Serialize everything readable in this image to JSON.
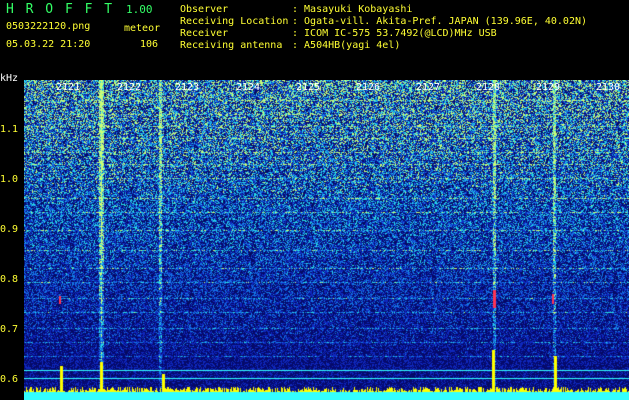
{
  "header": {
    "app_name": "H R O F F T",
    "version": "1.00",
    "filename": "0503222120.png",
    "mode": "meteor",
    "datetime": "05.03.22 21:20",
    "count": "106",
    "info_labels": [
      "Observer",
      "Receiving Location",
      "Receiver",
      "Receiving antenna"
    ],
    "info_values": [
      ": Masayuki Kobayashi",
      ": Ogata-vill. Akita-Pref. JAPAN (139.96E, 40.02N)",
      ": ICOM IC-575 53.7492(@LCD)MHz USB",
      ": A504HB(yagi 4el)"
    ]
  },
  "y_axis": {
    "unit": "kHz",
    "ticks": [
      "1.1",
      "1.0",
      "0.9",
      "0.8",
      "0.7",
      "0.6"
    ]
  },
  "x_axis": {
    "minutes": [
      "2121",
      "2122",
      "2123",
      "2124",
      "2125",
      "2126",
      "2127",
      "2128",
      "2129",
      "2130"
    ]
  },
  "colors": {
    "header_green": "#33ff66",
    "header_yellow": "#ffff33",
    "header_white": "#ffffff",
    "minute_labels": "#ffffff",
    "axis_ticks": "#ffff33",
    "trace_cyan": "#33ffff",
    "trace_yellow": "#ffff00"
  }
}
